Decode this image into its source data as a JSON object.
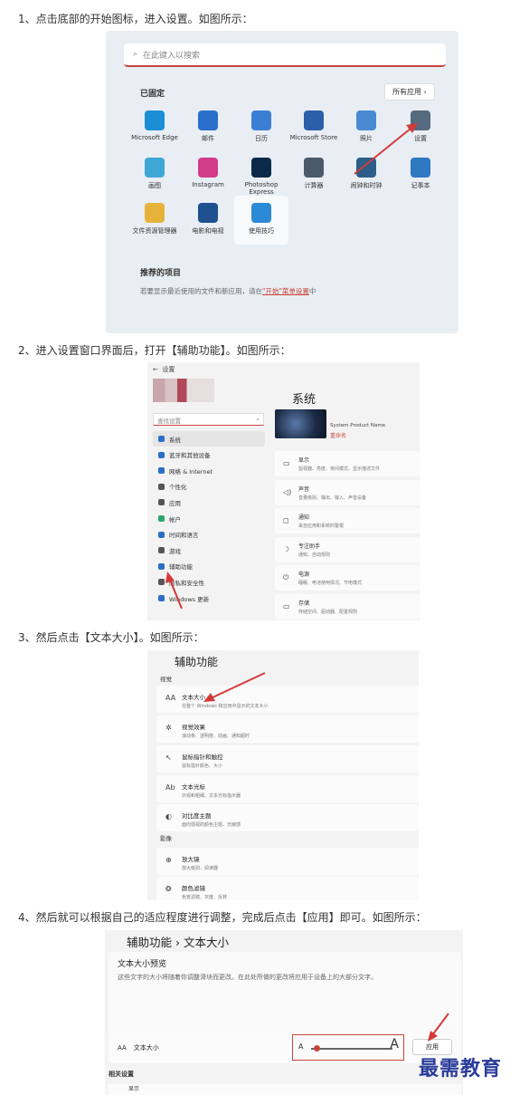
{
  "steps": [
    "1、点击底部的开始图标，进入设置。如图所示：",
    "2、进入设置窗口界面后，打开【辅助功能】。如图所示：",
    "3、然后点击【文本大小】。如图所示：",
    "4、然后就可以根据自己的适应程度进行调整，完成后点击【应用】即可。如图所示："
  ],
  "start_menu": {
    "search_placeholder": "在此键入以搜索",
    "pinned_title": "已固定",
    "all_apps": "所有应用",
    "apps": [
      {
        "label": "Microsoft Edge",
        "icon": "edge-icon",
        "color": "#1a8fd6"
      },
      {
        "label": "邮件",
        "icon": "mail-icon",
        "color": "#2a6fc9"
      },
      {
        "label": "日历",
        "icon": "calendar-icon",
        "color": "#3b7fd4"
      },
      {
        "label": "Microsoft Store",
        "icon": "store-icon",
        "color": "#2b5fa8"
      },
      {
        "label": "照片",
        "icon": "photos-icon",
        "color": "#4a8ad0"
      },
      {
        "label": "设置",
        "icon": "gear-icon",
        "color": "#566a80"
      },
      {
        "label": "画图",
        "icon": "paint-icon",
        "color": "#3fa7d6"
      },
      {
        "label": "Instagram",
        "icon": "instagram-icon",
        "color": "#d23c8a"
      },
      {
        "label": "Photoshop Express",
        "icon": "photoshop-icon",
        "color": "#0b2a4a"
      },
      {
        "label": "计算器",
        "icon": "calculator-icon",
        "color": "#4a5a6a"
      },
      {
        "label": "闹钟和时钟",
        "icon": "clock-icon",
        "color": "#2b5f8a"
      },
      {
        "label": "记事本",
        "icon": "notepad-icon",
        "color": "#2f78c4"
      },
      {
        "label": "文件资源管理器",
        "icon": "folder-icon",
        "color": "#e6b33a"
      },
      {
        "label": "电影和电视",
        "icon": "movies-icon",
        "color": "#1e4f8e"
      },
      {
        "label": "使用技巧",
        "icon": "tips-icon",
        "color": "#2b8ad8"
      }
    ],
    "recommended_title": "推荐的项目",
    "recommended_text_prefix": "若要显示最近使用的文件和新应用，请在",
    "recommended_link": "\"开始\"菜单设置",
    "recommended_text_suffix": "中"
  },
  "settings": {
    "window_title": "设置",
    "search_placeholder": "查找设置",
    "page_title": "系统",
    "device_model": "System Product Name",
    "rename": "重命名",
    "nav": [
      {
        "label": "系统",
        "icon": "system-icon",
        "color": "#2a6fc9"
      },
      {
        "label": "蓝牙和其他设备",
        "icon": "bluetooth-icon",
        "color": "#2a6fc9"
      },
      {
        "label": "网络 & Internet",
        "icon": "network-icon",
        "color": "#2a6fc9"
      },
      {
        "label": "个性化",
        "icon": "brush-icon",
        "color": "#555"
      },
      {
        "label": "应用",
        "icon": "apps-icon",
        "color": "#555"
      },
      {
        "label": "帐户",
        "icon": "account-icon",
        "color": "#2aa86a"
      },
      {
        "label": "时间和语言",
        "icon": "time-icon",
        "color": "#2a6fc9"
      },
      {
        "label": "游戏",
        "icon": "game-icon",
        "color": "#555"
      },
      {
        "label": "辅助功能",
        "icon": "accessibility-icon",
        "color": "#2a6fc9"
      },
      {
        "label": "隐私和安全性",
        "icon": "shield-icon",
        "color": "#555"
      },
      {
        "label": "Windows 更新",
        "icon": "update-icon",
        "color": "#2a6fc9"
      }
    ],
    "cards": [
      {
        "title": "显示",
        "sub": "监视器、亮度、夜间模式、显示描述文件",
        "icon": "display-icon"
      },
      {
        "title": "声音",
        "sub": "音量级别、输出、输入、声音设备",
        "icon": "sound-icon"
      },
      {
        "title": "通知",
        "sub": "来自应用和系统的警报",
        "icon": "notification-icon"
      },
      {
        "title": "专注助手",
        "sub": "通知、自动规则",
        "icon": "focus-icon"
      },
      {
        "title": "电源",
        "sub": "睡眠、电池使用情况、节电模式",
        "icon": "power-icon"
      },
      {
        "title": "存储",
        "sub": "存储空间、驱动器、配置规则",
        "icon": "storage-icon"
      }
    ]
  },
  "accessibility": {
    "title": "辅助功能",
    "section_vision": "视觉",
    "section_hearing": "影像",
    "rows": [
      {
        "title": "文本大小",
        "sub": "在整个 Windows 和应用中显示的文本大小",
        "icon": "text-size-icon",
        "glyph": "AA"
      },
      {
        "title": "视觉效果",
        "sub": "滚动条、透明度、动画、通知超时",
        "icon": "visual-effects-icon",
        "glyph": "✲"
      },
      {
        "title": "鼠标指针和触控",
        "sub": "鼠标指针颜色、大小",
        "icon": "mouse-pointer-icon",
        "glyph": "↖"
      },
      {
        "title": "文本光标",
        "sub": "外观和粗细、文本光标指示器",
        "icon": "text-cursor-icon",
        "glyph": "Ab"
      },
      {
        "title": "对比度主题",
        "sub": "面向弱视的颜色主题、光敏感",
        "icon": "contrast-icon",
        "glyph": "◐"
      },
      {
        "title": "放大镜",
        "sub": "放大级别、阅读器",
        "icon": "magnifier-icon",
        "glyph": "⊕"
      },
      {
        "title": "颜色滤镜",
        "sub": "色盲滤镜、灰度、反转",
        "icon": "color-filter-icon",
        "glyph": "❂"
      }
    ]
  },
  "text_size": {
    "breadcrumb": "辅助功能 › 文本大小",
    "preview_title": "文本大小预览",
    "preview_desc": "这些文字的大小将随着你调整滑块而更改。在此处所做的更改将应用于设备上的大部分文字。",
    "label": "文本大小",
    "label_icon_glyph": "AA",
    "slider_small": "A",
    "slider_large": "A",
    "slider_value": 0.05,
    "apply": "应用",
    "related": "相关设置",
    "partial_row": "显示"
  },
  "watermark": "最需教育"
}
